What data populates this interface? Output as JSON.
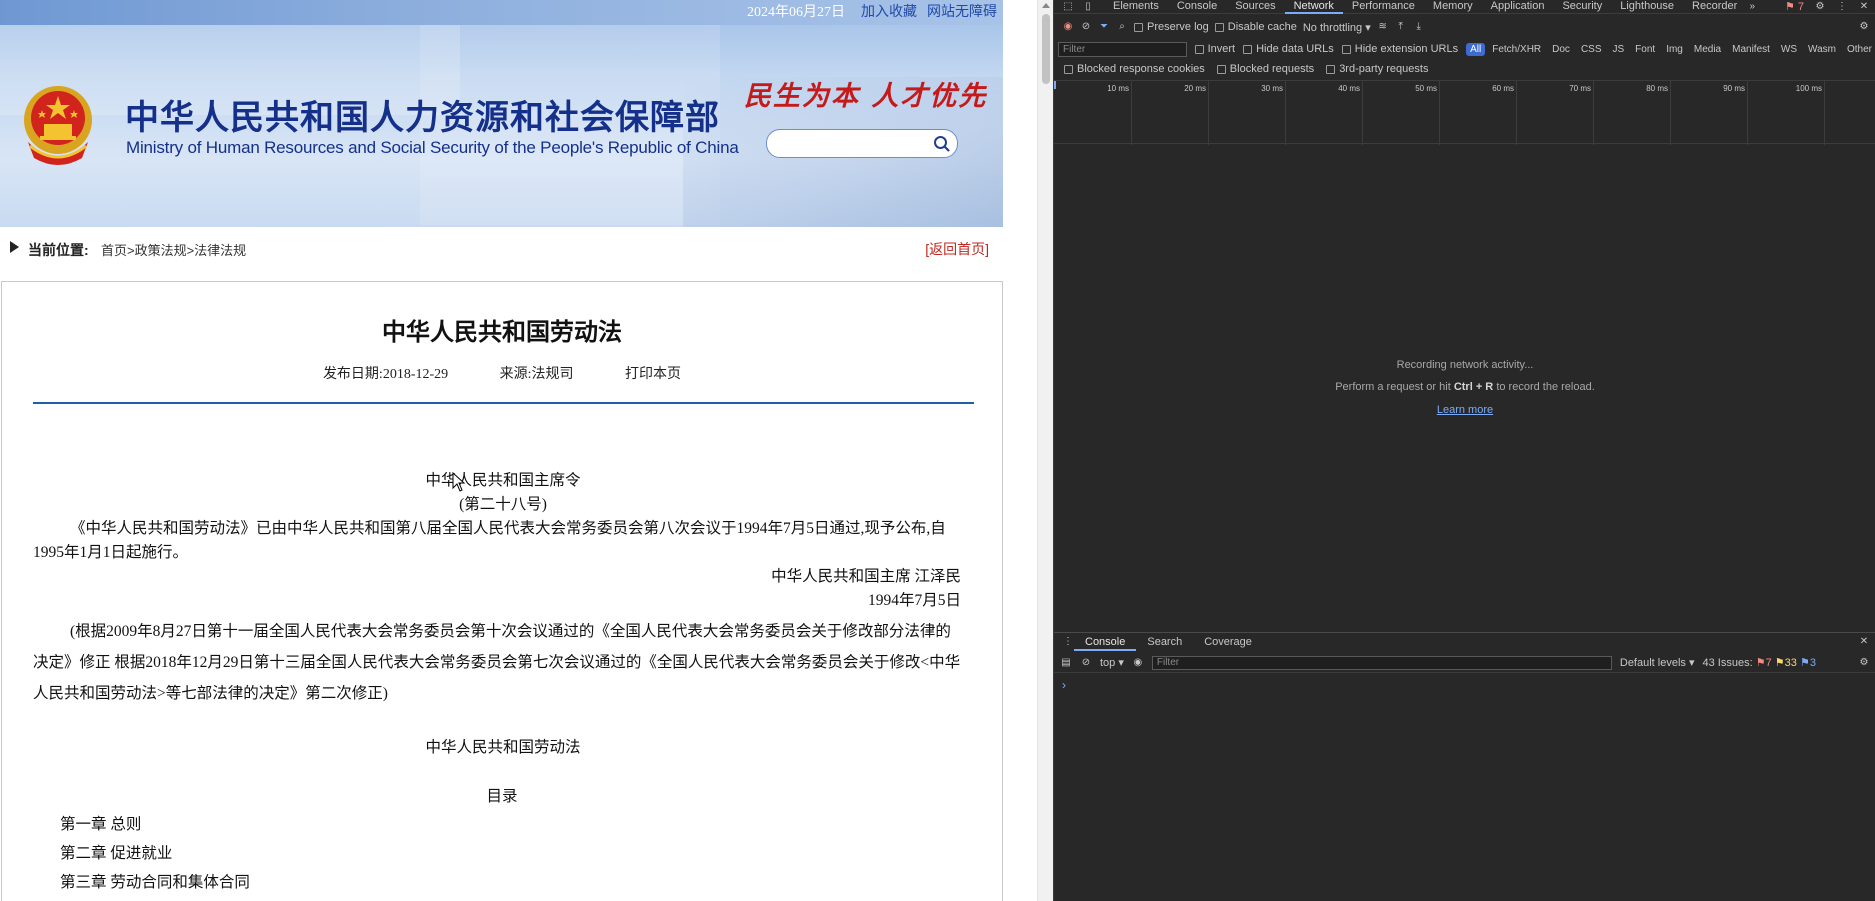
{
  "header": {
    "date": "2024年06月27日",
    "favorite": "加入收藏",
    "accessibility": "网站无障碍",
    "title_cn": "中华人民共和国人力资源和社会保障部",
    "title_en": "Ministry of Human Resources and Social Security of the People's Republic of China",
    "slogan": "民生为本  人才优先",
    "search_placeholder": ""
  },
  "breadcrumb": {
    "label": "当前位置:",
    "path": "首页>政策法规>法律法规",
    "back": "[返回首页]"
  },
  "article": {
    "title": "中华人民共和国劳动法",
    "publish_date": "发布日期:2018-12-29",
    "source": "来源:法规司",
    "print": "打印本页",
    "order_title": "中华人民共和国主席令",
    "order_no": "(第二十八号)",
    "para1": "《中华人民共和国劳动法》已由中华人民共和国第八届全国人民代表大会常务委员会第八次会议于1994年7月5日通过,现予公布,自1995年1月1日起施行。",
    "signer": "中华人民共和国主席 江泽民",
    "sign_date": "1994年7月5日",
    "para2": "(根据2009年8月27日第十一届全国人民代表大会常务委员会第十次会议通过的《全国人民代表大会常务委员会关于修改部分法律的决定》修正 根据2018年12月29日第十三届全国人民代表大会常务委员会第七次会议通过的《全国人民代表大会常务委员会关于修改<中华人民共和国劳动法>等七部法律的决定》第二次修正)",
    "law_title": "中华人民共和国劳动法",
    "toc": "目录",
    "chapters": [
      "第一章 总则",
      "第二章 促进就业",
      "第三章 劳动合同和集体合同"
    ]
  },
  "devtools": {
    "tabs": [
      "Elements",
      "Console",
      "Sources",
      "Network",
      "Performance",
      "Memory",
      "Application",
      "Security",
      "Lighthouse",
      "Recorder"
    ],
    "active_tab": "Network",
    "issues_count": "7",
    "toolbar": {
      "preserve_log": "Preserve log",
      "disable_cache": "Disable cache",
      "throttling": "No throttling"
    },
    "filter": {
      "placeholder": "Filter",
      "invert": "Invert",
      "hide_data_urls": "Hide data URLs",
      "hide_extension_urls": "Hide extension URLs",
      "types": [
        "All",
        "Fetch/XHR",
        "Doc",
        "CSS",
        "JS",
        "Font",
        "Img",
        "Media",
        "Manifest",
        "WS",
        "Wasm",
        "Other"
      ]
    },
    "block": {
      "blocked_cookies": "Blocked response cookies",
      "blocked_requests": "Blocked requests",
      "third_party": "3rd-party requests"
    },
    "timeline_ticks": [
      "10 ms",
      "20 ms",
      "30 ms",
      "40 ms",
      "50 ms",
      "60 ms",
      "70 ms",
      "80 ms",
      "90 ms",
      "100 ms"
    ],
    "empty": {
      "line1": "Recording network activity...",
      "line2_pre": "Perform a request or hit",
      "line2_key": "Ctrl + R",
      "line2_post": "to record the reload.",
      "learn": "Learn more"
    },
    "drawer": {
      "tabs": [
        "Console",
        "Search",
        "Coverage"
      ],
      "context": "top",
      "filter_placeholder": "Filter",
      "levels": "Default levels",
      "issues_label": "43 Issues:",
      "issues_red": "7",
      "issues_orange": "33",
      "issues_blue": "3"
    }
  }
}
